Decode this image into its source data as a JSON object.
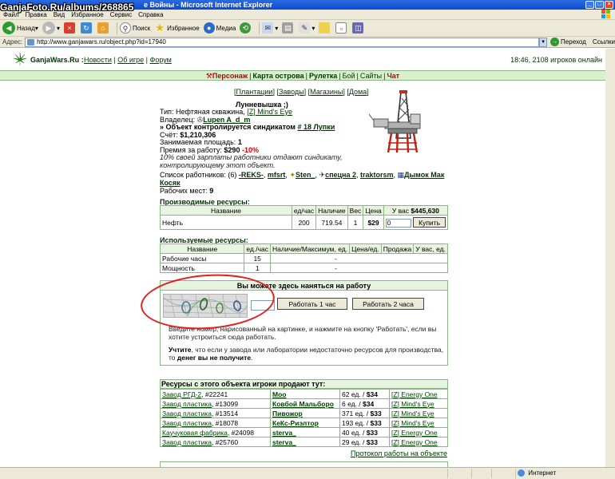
{
  "browser": {
    "title": "е Войны - Microsoft Internet Explorer",
    "menu": [
      "Файл",
      "Правка",
      "Вид",
      "Избранное",
      "Сервис",
      "Справка"
    ],
    "toolbar": {
      "back": "Назад",
      "search": "Поиск",
      "favorites": "Избранное",
      "media": "Медиа"
    },
    "address_label": "Адрес:",
    "url": "http://www.ganjawars.ru/object.php?id=17940",
    "go": "Переход",
    "links": "Ссылки",
    "status_zone": "Интернет",
    "watermark": "GanjaFoto.Ru/albums/268865"
  },
  "site": {
    "name": "GanjaWars.Ru",
    "name_sep": " :",
    "nav": [
      "Новости",
      "Об игре",
      "Форум"
    ],
    "time": "18:46, 2108 игроков онлайн"
  },
  "mainbar": {
    "items": [
      {
        "label": "Персонаж",
        "style": "red"
      },
      {
        "label": "Карта острова",
        "style": "bold"
      },
      {
        "label": "Рулетка",
        "style": "bold"
      },
      {
        "label": "Бой",
        "style": "norm"
      },
      {
        "label": "Сайты",
        "style": "norm"
      },
      {
        "label": "Чат",
        "style": "red"
      }
    ]
  },
  "subnav": [
    "Плантации",
    "Заводы",
    "Магазины",
    "Дома"
  ],
  "object": {
    "title": "Лунневышка ;)",
    "type_label": "Тип:",
    "type_value": "Нефтяная скважина,",
    "type_link": "[Z] Mind's Eye",
    "owner_label": "Владелец:",
    "owner": "Lupen A_d_m",
    "syndicate_prefix": "» Объект контролируется синдикатом",
    "syndicate": "# 18 Лупки",
    "account_label": "Счёт:",
    "account": "$1,210,306",
    "area_label": "Занимаемая площадь:",
    "area": "1",
    "premium_label": "Премия за работу:",
    "premium": "$290",
    "premium_pct": "-10%",
    "note": "10% своей зарплаты работники отдают синдикату, контролирующему этот объект."
  },
  "workers": {
    "label": "Список работников: (6)",
    "names": [
      "-REKS-",
      "mfsrt",
      "Sten_",
      "спецна 2",
      "traktorsm",
      "Дымок Мак Косяк"
    ],
    "places_label": "Рабочих мест:",
    "places": "9"
  },
  "produced": {
    "title": "Производимые ресурсы:",
    "headers": [
      "Название",
      "ед/час",
      "Наличие",
      "Вес",
      "Цена",
      "У вас"
    ],
    "balance": "$445,630",
    "row": {
      "name": "Нефть",
      "rate": "200",
      "stock": "719.54",
      "weight": "1",
      "price": "$29",
      "qty": "0"
    },
    "buy": "Купить"
  },
  "used": {
    "title": "Используемые ресурсы:",
    "headers": [
      "Название",
      "ед./час",
      "Наличие/Максимум, ед.",
      "Цена/ед.",
      "Продажа",
      "У вас, ед."
    ],
    "rows": [
      {
        "name": "Рабочие часы",
        "rate": "15",
        "price": "-"
      },
      {
        "name": "Мощность",
        "rate": "1",
        "price": "-"
      }
    ]
  },
  "hire": {
    "title": "Вы можете здесь наняться на работу",
    "btn1": "Работать 1 час",
    "btn2": "Работать 2 часа",
    "text1": "Введите номер, нарисованный на картинке, и нажмите на кнопку 'Работать', если вы хотите устроиться сюда работать.",
    "text2_bold": "Учтите",
    "text2": ", что если у завода или лаборатории недостаточно ресурсов для производства, то",
    "text2_end": "денег вы не получите",
    "text2_dot": "."
  },
  "sellers": {
    "title": "Ресурсы с этого объекта игроки продают тут:",
    "rows": [
      {
        "place": "Завод РГД-2",
        "num": ", #22241",
        "seller": "Moo",
        "offer": "62 ед. / ",
        "price": "$34",
        "synd": "[Z] Energy One"
      },
      {
        "place": "Завод пластика",
        "num": ", #13099",
        "seller": "Ковбой Мальборо",
        "offer": "6 ед. / ",
        "price": "$34",
        "synd": "[Z] Mind's Eye"
      },
      {
        "place": "Завод пластика",
        "num": ", #13514",
        "seller": "Пивожор",
        "offer": "371 ед. / ",
        "price": "$33",
        "synd": "[Z] Mind's Eye"
      },
      {
        "place": "Завод пластика",
        "num": ", #18078",
        "seller": "КеКс-Риэлтор",
        "offer": "193 ед. / ",
        "price": "$33",
        "synd": "[Z] Mind's Eye"
      },
      {
        "place": "Каучуковая фабрика",
        "num": ", #24098",
        "seller": "sterva_",
        "offer": "40 ед. / ",
        "price": "$33",
        "synd": "[Z] Energy One"
      },
      {
        "place": "Завод пластика",
        "num": ", #25760",
        "seller": "sterva_",
        "offer": "29 ед. / ",
        "price": "$33",
        "synd": "[Z] Energy One"
      }
    ]
  },
  "protocol": "Протокол работы на объекте"
}
